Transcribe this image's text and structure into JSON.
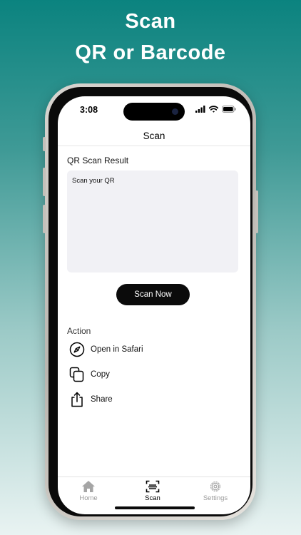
{
  "promo": {
    "line1": "Scan",
    "line2": "QR or Barcode"
  },
  "status_bar": {
    "time": "3:08",
    "icons": [
      "signal-icon",
      "wifi-icon",
      "battery-icon"
    ]
  },
  "nav": {
    "title": "Scan"
  },
  "result": {
    "label": "QR Scan Result",
    "text": "Scan your QR"
  },
  "scan_button": {
    "label": "Scan Now"
  },
  "actions": {
    "label": "Action",
    "items": [
      {
        "label": "Open in Safari",
        "icon": "compass-icon"
      },
      {
        "label": "Copy",
        "icon": "copy-icon"
      },
      {
        "label": "Share",
        "icon": "share-icon"
      }
    ]
  },
  "tabbar": {
    "tabs": [
      {
        "label": "Home",
        "icon": "home-icon",
        "active": false
      },
      {
        "label": "Scan",
        "icon": "scan-icon",
        "active": true
      },
      {
        "label": "Settings",
        "icon": "gear-icon",
        "active": false
      }
    ]
  },
  "colors": {
    "background_top": "#0b837f",
    "background_bottom": "#e9f3f2",
    "button": "#0b0b0b",
    "result_box": "#f1f1f5",
    "tab_active": "#000000",
    "tab_inactive": "#9b9b9b"
  }
}
